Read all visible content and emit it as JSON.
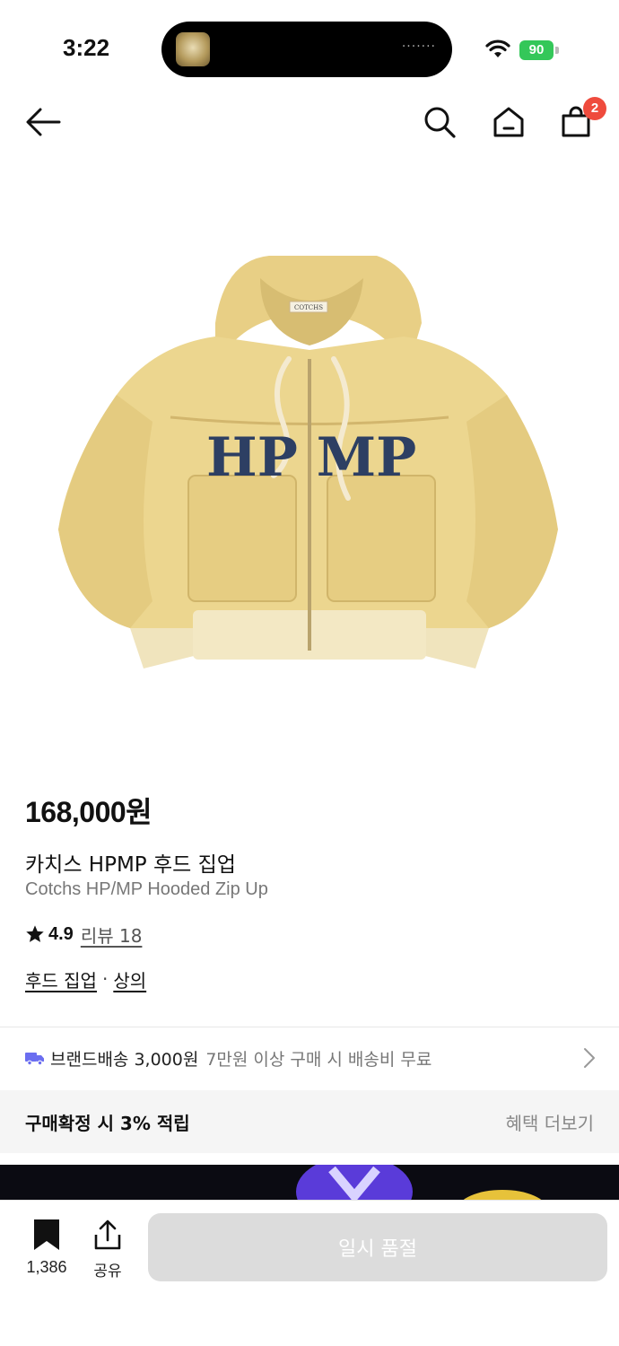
{
  "status_bar": {
    "time": "3:22",
    "island_dots": "·······",
    "battery": "90"
  },
  "nav": {
    "back_icon": "arrow-left-icon",
    "search_icon": "search-icon",
    "home_icon": "home-icon",
    "cart_icon": "shopping-bag-icon",
    "cart_badge": "2"
  },
  "product": {
    "image_desc_icon": "product-photo",
    "jacket_text": "HP MP",
    "neck_label": "COTCHS",
    "price": "168,000원",
    "name_ko": "카치스 HPMP 후드 집업",
    "name_en": "Cotchs HP/MP Hooded Zip Up",
    "rating": "4.9",
    "review_label": "리뷰 18",
    "categories": [
      "후드 집업",
      "상의"
    ],
    "category_separator": "·"
  },
  "shipping": {
    "icon": "truck-icon",
    "label": "브랜드배송 3,000원",
    "sub": "7만원 이상 구매 시 배송비 무료"
  },
  "benefit": {
    "title": "구매확정 시 3% 적립",
    "more": "혜택 더보기"
  },
  "bottom_bar": {
    "bookmark_count": "1,386",
    "share_label": "공유",
    "soldout_label": "일시 품절"
  },
  "colors": {
    "badge": "#ef4b3d",
    "battery": "#34c759",
    "shipping_icon": "#6b6ef0",
    "soldout_bg": "#dcdcdc",
    "jacket": "#ecd68f"
  }
}
